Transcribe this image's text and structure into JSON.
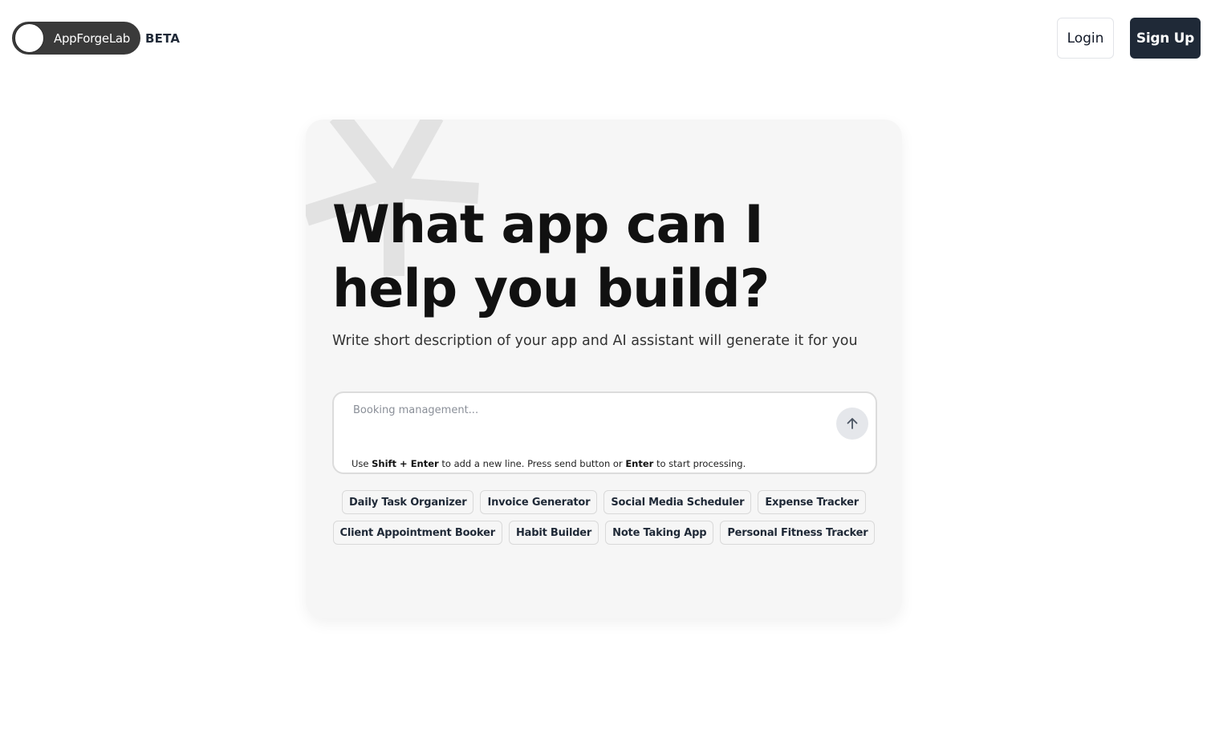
{
  "header": {
    "brand": "AppForgeLab",
    "badge": "BETA",
    "login_label": "Login",
    "signup_label": "Sign Up"
  },
  "hero": {
    "headline": "What app can I help you build?",
    "subtitle": "Write short description of your app and AI assistant will generate it for you"
  },
  "prompt": {
    "placeholder": "Booking management...",
    "value": "",
    "hint_parts": [
      "Use ",
      "Shift + Enter",
      " to add a new line. Press send button or ",
      "Enter",
      " to start processing."
    ],
    "send_icon": "arrow-up-icon"
  },
  "suggestions": {
    "row1": [
      "Daily Task Organizer",
      "Invoice Generator",
      "Social Media Scheduler",
      "Expense Tracker"
    ],
    "row2": [
      "Client Appointment Booker",
      "Habit Builder",
      "Note Taking App",
      "Personal Fitness Tracker"
    ]
  },
  "colors": {
    "primary_dark": "#1f2937",
    "card_bg": "#f6f6f6",
    "logo_pill": "#3a3a3a"
  }
}
